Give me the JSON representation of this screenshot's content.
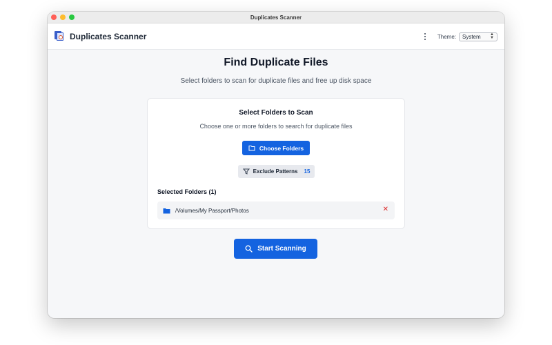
{
  "window": {
    "title": "Duplicates Scanner"
  },
  "header": {
    "app_title": "Duplicates Scanner",
    "theme_label": "Theme:",
    "theme_value": "System"
  },
  "main": {
    "title": "Find Duplicate Files",
    "subtitle": "Select folders to scan for duplicate files and free up disk space"
  },
  "card": {
    "title": "Select Folders to Scan",
    "subtitle": "Choose one or more folders to search for duplicate files",
    "choose_label": "Choose Folders",
    "exclude_label": "Exclude Patterns",
    "exclude_count": "15",
    "selected_heading": "Selected Folders (1)",
    "folders": [
      {
        "path": "/Volumes/My Passport/Photos"
      }
    ]
  },
  "actions": {
    "start_label": "Start Scanning"
  },
  "colors": {
    "accent": "#1463e0",
    "remove": "#dc2626"
  },
  "icons": [
    "app-logo-icon",
    "more-vertical-icon",
    "folder-outline-icon",
    "filter-icon",
    "folder-filled-icon",
    "close-icon",
    "search-icon"
  ]
}
